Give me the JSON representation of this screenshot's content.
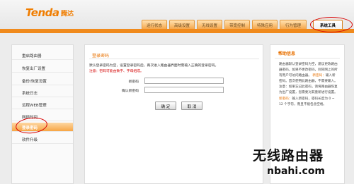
{
  "brand": {
    "logo_text": "Tenda",
    "logo_cn": "腾达"
  },
  "nav": {
    "tabs": [
      {
        "label": "运行状态",
        "active": false
      },
      {
        "label": "高级设置",
        "active": false
      },
      {
        "label": "无线设置",
        "active": false
      },
      {
        "label": "带宽控制",
        "active": false
      },
      {
        "label": "特殊应用",
        "active": false
      },
      {
        "label": "行为管理",
        "active": false
      },
      {
        "label": "系统工具",
        "active": true
      }
    ]
  },
  "sidebar": {
    "items": [
      {
        "label": "重启路由器",
        "active": false
      },
      {
        "label": "恢复出厂设置",
        "active": false
      },
      {
        "label": "备份/恢复设置",
        "active": false
      },
      {
        "label": "系统日志",
        "active": false
      },
      {
        "label": "远程WEB管理",
        "active": false
      },
      {
        "label": "网络时间",
        "active": false
      },
      {
        "label": "登录密码",
        "active": true
      },
      {
        "label": "软件升级",
        "active": false
      }
    ]
  },
  "main": {
    "title": "登录密码",
    "description": "默认登录密码为空，设置登录密码后，再次进入路由器界面时需输入正确的登录密码。",
    "note": "注意：密码可能由数字、字母组成。",
    "fields": [
      {
        "label": "新密码",
        "value": ""
      },
      {
        "label": "确认新密码",
        "value": ""
      }
    ],
    "ok_label": "确 定",
    "cancel_label": "取 消"
  },
  "help": {
    "title": "帮助信息",
    "intro": "路由器默认登录密码为空，建议更改路由器密码，如果不更改密码，则同网上的所有用户可访问路由器。",
    "items": [
      {
        "key": "新密码：",
        "text": "输入新密码。首次使用此路由器，不需要输入。"
      },
      {
        "key": "",
        "text": "注意：如果忘记此密码，请将路由器恢复为出厂设置，您需要对其重新进行设置。"
      },
      {
        "key": "新密码：",
        "text": "输入新密码，密码长度为 0 ~ 12 个字符，而且不能包含空格。"
      }
    ]
  },
  "watermark": {
    "cn": "无线路由器",
    "url": "nbahi.com"
  }
}
